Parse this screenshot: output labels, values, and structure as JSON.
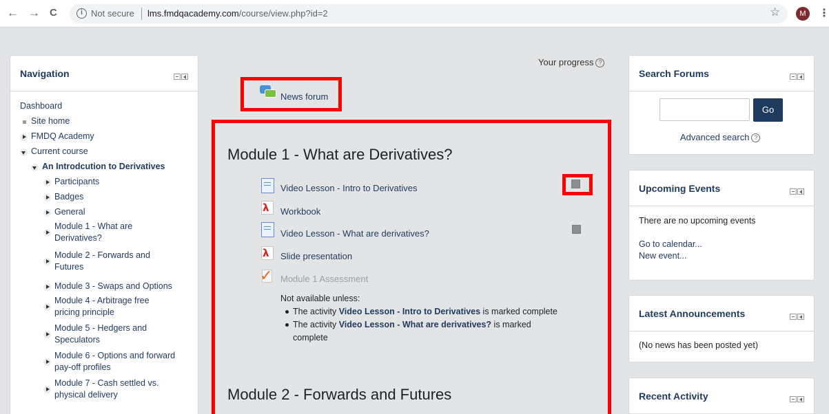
{
  "browser": {
    "back": "←",
    "forward": "→",
    "reload": "C",
    "security_label": "Not secure",
    "url_host": "lms.fmdqacademy.com",
    "url_path": "/course/view.php?id=2",
    "avatar_letter": "M",
    "star": "☆",
    "menu": "⋮"
  },
  "navigation": {
    "title": "Navigation",
    "dashboard": "Dashboard",
    "site_home": "Site home",
    "fmdq_academy": "FMDQ Academy",
    "current_course": "Current course",
    "course_name": "An Introdcution to Derivatives",
    "items": [
      {
        "line1": "Participants",
        "line2": ""
      },
      {
        "line1": "Badges",
        "line2": ""
      },
      {
        "line1": "General",
        "line2": ""
      },
      {
        "line1": "Module 1 - What are",
        "line2": "Derivatives?"
      },
      {
        "line1": "Module 2 - Forwards and",
        "line2": "Futures"
      },
      {
        "line1": "Module 3 - Swaps and Options",
        "line2": ""
      },
      {
        "line1": "Module 4 - Arbitrage free",
        "line2": "pricing principle"
      },
      {
        "line1": "Module 5 - Hedgers and",
        "line2": "Speculators"
      },
      {
        "line1": "Module 6 - Options and forward",
        "line2": "pay-off profiles"
      },
      {
        "line1": "Module 7 - Cash settled vs.",
        "line2": "physical delivery"
      }
    ]
  },
  "main": {
    "your_progress": "Your progress",
    "help_glyph": "?",
    "news_forum": "News forum",
    "module1_title": "Module 1 - What are Derivatives?",
    "module2_title": "Module 2 - Forwards and Futures",
    "activities": [
      {
        "label": "Video Lesson - Intro to Derivatives",
        "type": "page"
      },
      {
        "label": "Workbook",
        "type": "pdf"
      },
      {
        "label": "Video Lesson - What are derivatives?",
        "type": "page"
      },
      {
        "label": "Slide presentation",
        "type": "pdf"
      },
      {
        "label": "Module 1 Assessment",
        "type": "quiz"
      }
    ],
    "restriction": {
      "heading": "Not available unless:",
      "rule1_prefix": "The activity ",
      "rule1_bold": "Video Lesson - Intro to Derivatives",
      "rule1_suffix": " is marked complete",
      "rule2_prefix": "The activity ",
      "rule2_bold": "Video Lesson - What are derivatives?",
      "rule2_suffix": " is marked",
      "rule2_line2": "complete"
    }
  },
  "search_forums": {
    "title": "Search Forums",
    "query": "",
    "go_label": "Go",
    "advanced": "Advanced search"
  },
  "upcoming_events": {
    "title": "Upcoming Events",
    "empty": "There are no upcoming events",
    "calendar_link": "Go to calendar...",
    "new_event_link": "New event..."
  },
  "latest_announcements": {
    "title": "Latest Announcements",
    "empty": "(No news has been posted yet)"
  },
  "recent_activity": {
    "title": "Recent Activity"
  },
  "colors": {
    "highlight": "#ff0000",
    "brand": "#1e3a5f"
  }
}
